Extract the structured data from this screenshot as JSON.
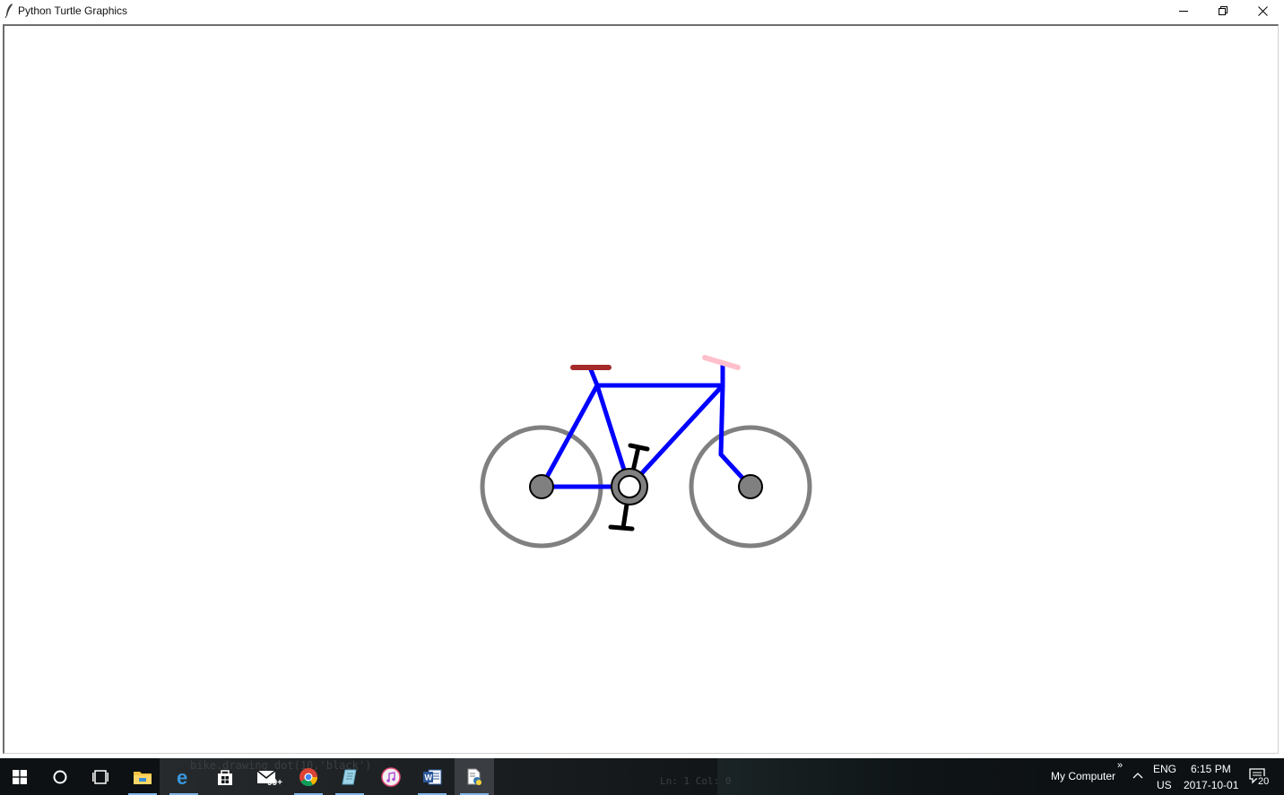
{
  "window": {
    "title": "Python Turtle Graphics"
  },
  "canvas": {
    "background": "#ffffff",
    "drawing": "bicycle",
    "colors": {
      "wheel": "#808080",
      "frame": "#0000ff",
      "seat": "#a52a2a",
      "handlebar": "#ffc0cb",
      "pedals": "#000000",
      "chainring": "#808080"
    }
  },
  "background_editor": {
    "code_line": "bike.drawing_dot(10,'black')",
    "status": "Ln: 1   Col: 0"
  },
  "taskbar": {
    "icons": [
      "windows-start-icon",
      "search-circle-icon",
      "task-view-icon",
      "file-explorer-icon",
      "edge-icon",
      "store-icon",
      "mail-icon",
      "chrome-icon",
      "notepad-icon",
      "itunes-icon",
      "word-icon",
      "python-idle-icon"
    ],
    "mail_badge": "99+",
    "my_computer": "My Computer",
    "overflow_chevron": "»",
    "language_top": "ENG",
    "language_bottom": "US",
    "time": "6:15 PM",
    "date": "2017-10-01",
    "notification_count": "20"
  }
}
